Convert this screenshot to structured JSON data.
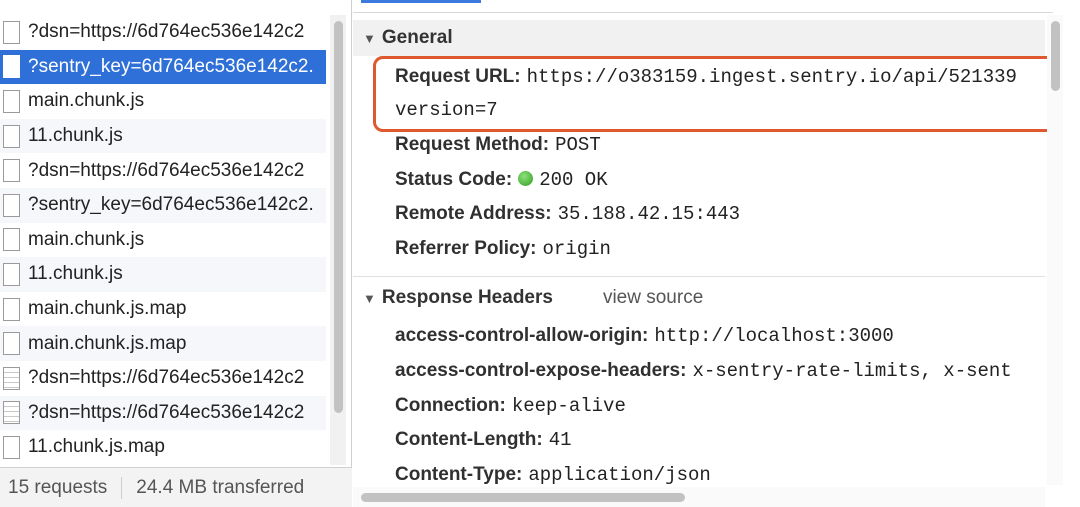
{
  "requests": [
    {
      "name": "?dsn=https://6d764ec536e142c2",
      "icon": "file-icon",
      "selected": false
    },
    {
      "name": "?sentry_key=6d764ec536e142c2.",
      "icon": "file-icon",
      "selected": true
    },
    {
      "name": "main.chunk.js",
      "icon": "file-icon",
      "selected": false
    },
    {
      "name": "11.chunk.js",
      "icon": "file-icon",
      "selected": false
    },
    {
      "name": "?dsn=https://6d764ec536e142c2",
      "icon": "file-icon",
      "selected": false
    },
    {
      "name": "?sentry_key=6d764ec536e142c2.",
      "icon": "file-icon",
      "selected": false
    },
    {
      "name": "main.chunk.js",
      "icon": "file-icon",
      "selected": false
    },
    {
      "name": "11.chunk.js",
      "icon": "file-icon",
      "selected": false
    },
    {
      "name": "main.chunk.js.map",
      "icon": "file-icon",
      "selected": false
    },
    {
      "name": "main.chunk.js.map",
      "icon": "file-icon",
      "selected": false
    },
    {
      "name": "?dsn=https://6d764ec536e142c2",
      "icon": "document-icon",
      "selected": false
    },
    {
      "name": "?dsn=https://6d764ec536e142c2",
      "icon": "document-icon",
      "selected": false
    },
    {
      "name": "11.chunk.js.map",
      "icon": "file-icon",
      "selected": false
    }
  ],
  "status_bar": {
    "requests_count": "15 requests",
    "transferred": "24.4 MB transferred"
  },
  "general": {
    "title": "General",
    "request_url_label": "Request URL:",
    "request_url_value": "https://o383159.ingest.sentry.io/api/521339",
    "request_url_cont": "version=7",
    "request_method_label": "Request Method:",
    "request_method_value": "POST",
    "status_code_label": "Status Code:",
    "status_code_value": "200 OK",
    "remote_address_label": "Remote Address:",
    "remote_address_value": "35.188.42.15:443",
    "referrer_policy_label": "Referrer Policy:",
    "referrer_policy_value": "origin"
  },
  "response_headers": {
    "title": "Response Headers",
    "view_source": "view source",
    "acao_label": "access-control-allow-origin:",
    "acao_value": "http://localhost:3000",
    "aceh_label": "access-control-expose-headers:",
    "aceh_value": "x-sentry-rate-limits, x-sent",
    "connection_label": "Connection:",
    "connection_value": "keep-alive",
    "content_length_label": "Content-Length:",
    "content_length_value": "41",
    "content_type_label": "Content-Type:",
    "content_type_value": "application/json"
  },
  "colors": {
    "selection": "#2e6fd8",
    "highlight_box": "#e0582e",
    "status_ok": "#3fae2a"
  }
}
